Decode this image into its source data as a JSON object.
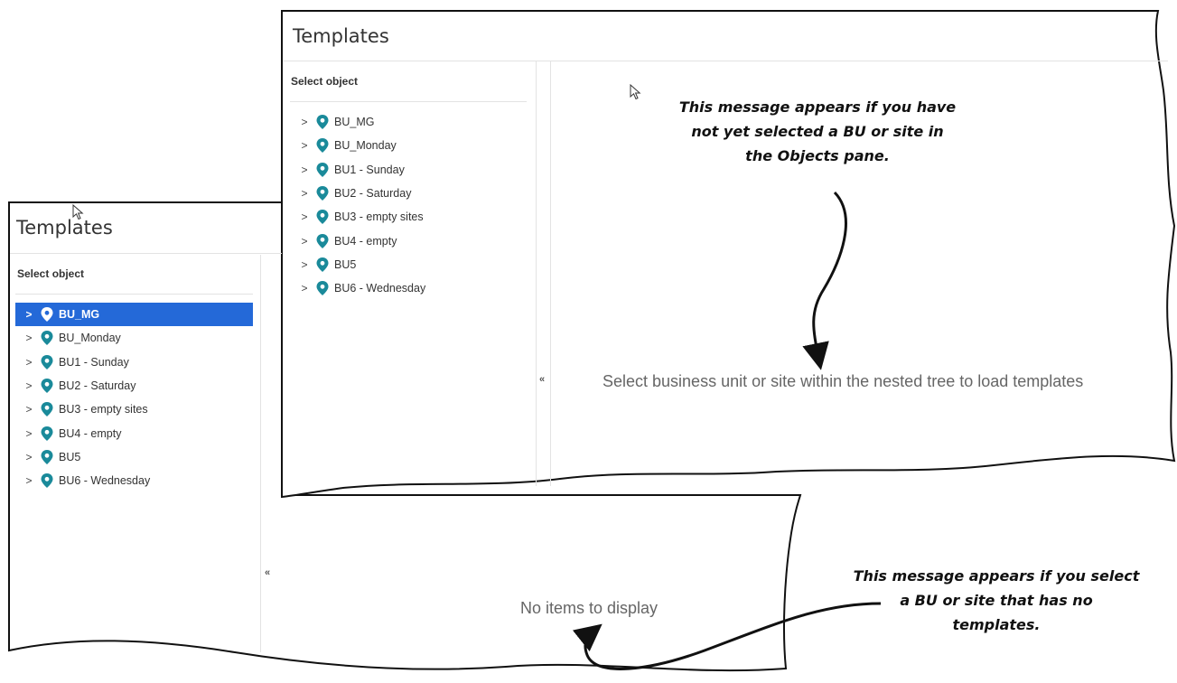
{
  "back_panel": {
    "title": "Templates",
    "select_label": "Select object",
    "tree": [
      {
        "label": "BU_MG",
        "selected": true
      },
      {
        "label": "BU_Monday"
      },
      {
        "label": "BU1 - Sunday"
      },
      {
        "label": "BU2 - Saturday"
      },
      {
        "label": "BU3 - empty sites"
      },
      {
        "label": "BU4 - empty"
      },
      {
        "label": "BU5"
      },
      {
        "label": "BU6 - Wednesday"
      }
    ],
    "collapse_glyph": "«",
    "message": "No items to display"
  },
  "front_panel": {
    "title": "Templates",
    "select_label": "Select object",
    "tree": [
      {
        "label": "BU_MG"
      },
      {
        "label": "BU_Monday"
      },
      {
        "label": "BU1 - Sunday"
      },
      {
        "label": "BU2 - Saturday"
      },
      {
        "label": "BU3 - empty sites"
      },
      {
        "label": "BU4 - empty"
      },
      {
        "label": "BU5"
      },
      {
        "label": "BU6 - Wednesday"
      }
    ],
    "collapse_glyph": "«",
    "message": "Select business unit or site within the nested tree to load templates"
  },
  "annotations": {
    "top": [
      "This message appears if you have",
      "not yet selected a BU or site in",
      "the Objects pane."
    ],
    "bottom": [
      "This message appears if you select",
      "a BU or site that has no",
      "templates."
    ]
  },
  "colors": {
    "pin": "#1a8a9a",
    "selected_bg": "#2469d8"
  },
  "icons": {
    "expand": "chevron-right-icon",
    "location": "map-pin-icon",
    "collapse": "double-chevron-left-icon",
    "cursor": "mouse-pointer-icon"
  }
}
